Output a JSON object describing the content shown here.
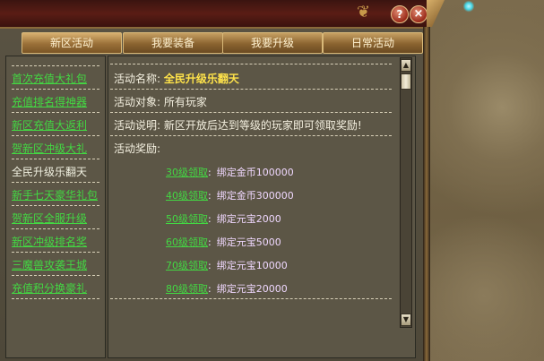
{
  "window": {
    "help_label": "?",
    "close_label": "×"
  },
  "tabs": [
    "新区活动",
    "我要装备",
    "我要升级",
    "日常活动"
  ],
  "activity_list": [
    "首次充值大礼包",
    "充值排名得神器",
    "新区充值大返利",
    "贺新区冲级大礼",
    "全民升级乐翻天",
    "新手七天豪华礼包",
    "贺新区全服升级",
    "新区冲级排名奖",
    "三魔兽攻袭王城",
    "充值积分换豪礼"
  ],
  "selected_index": 4,
  "detail": {
    "name_label": "活动名称:",
    "name_value": "全民升级乐翻天",
    "target_label": "活动对象:",
    "target_value": "所有玩家",
    "desc_label": "活动说明:",
    "desc_value": "新区开放后达到等级的玩家即可领取奖励!",
    "reward_label": "活动奖励:"
  },
  "rewards": [
    {
      "link": "30级领取",
      "colon": ":",
      "desc": "绑定金币100000"
    },
    {
      "link": "40级领取",
      "colon": ":",
      "desc": "绑定金币300000"
    },
    {
      "link": "50级领取",
      "colon": ":",
      "desc": "绑定元宝2000"
    },
    {
      "link": "60级领取",
      "colon": ":",
      "desc": "绑定元宝5000"
    },
    {
      "link": "70级领取",
      "colon": ":",
      "desc": "绑定元宝10000"
    },
    {
      "link": "80级领取",
      "colon": ":",
      "desc": "绑定元宝20000"
    }
  ],
  "scroll": {
    "up": "▲",
    "down": "▼"
  },
  "colors": {
    "link": "#43d843",
    "name": "#ffe34a",
    "reward_desc": "#f0d8ff"
  }
}
